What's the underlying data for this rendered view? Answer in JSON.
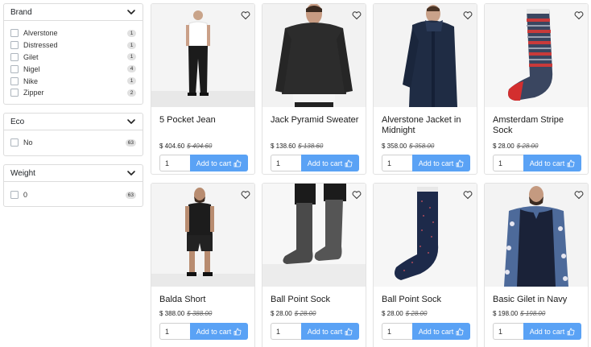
{
  "filters": [
    {
      "title": "Brand",
      "options": [
        {
          "label": "Alverstone",
          "count": "1"
        },
        {
          "label": "Distressed",
          "count": "1"
        },
        {
          "label": "Gilet",
          "count": "1"
        },
        {
          "label": "Nigel",
          "count": "4"
        },
        {
          "label": "Nike",
          "count": "1"
        },
        {
          "label": "Zipper",
          "count": "2"
        }
      ]
    },
    {
      "title": "Eco",
      "options": [
        {
          "label": "No",
          "count": "63"
        }
      ]
    },
    {
      "title": "Weight",
      "options": [
        {
          "label": "0",
          "count": "63"
        }
      ]
    }
  ],
  "products": [
    {
      "name": "5 Pocket Jean",
      "price": "$ 404.60",
      "old_price": "$ 404.60",
      "qty": "1",
      "cta": "Add to cart",
      "image_icon": "man-white-tee-black-jeans"
    },
    {
      "name": "Jack Pyramid Sweater",
      "price": "$ 138.60",
      "old_price": "$ 138.60",
      "qty": "1",
      "cta": "Add to cart",
      "image_icon": "man-dark-sweater"
    },
    {
      "name": "Alverstone Jacket in Midnight",
      "price": "$ 358.00",
      "old_price": "$ 358.00",
      "qty": "1",
      "cta": "Add to cart",
      "image_icon": "man-navy-parka"
    },
    {
      "name": "Amsterdam Stripe Sock",
      "price": "$ 28.00",
      "old_price": "$ 28.00",
      "qty": "1",
      "cta": "Add to cart",
      "image_icon": "striped-sock"
    },
    {
      "name": "Balda Short",
      "price": "$ 388.00",
      "old_price": "$ 388.00",
      "qty": "1",
      "cta": "Add to cart",
      "image_icon": "man-black-shorts"
    },
    {
      "name": "Ball Point Sock",
      "price": "$ 28.00",
      "old_price": "$ 28.00",
      "qty": "1",
      "cta": "Add to cart",
      "image_icon": "grey-socks-worn"
    },
    {
      "name": "Ball Point Sock",
      "price": "$ 28.00",
      "old_price": "$ 28.00",
      "qty": "1",
      "cta": "Add to cart",
      "image_icon": "navy-dotted-sock"
    },
    {
      "name": "Basic Gilet in Navy",
      "price": "$ 198.00",
      "old_price": "$ 198.00",
      "qty": "1",
      "cta": "Add to cart",
      "image_icon": "man-navy-gilet"
    }
  ],
  "icons": {
    "heart": "heart-outline-icon",
    "chevron": "chevron-down-icon",
    "cart_button_icon": "thumbs-up-icon"
  },
  "colors": {
    "accent": "#5aa2f5",
    "border": "#dcdcdc",
    "badge": "#e0e0e0"
  }
}
